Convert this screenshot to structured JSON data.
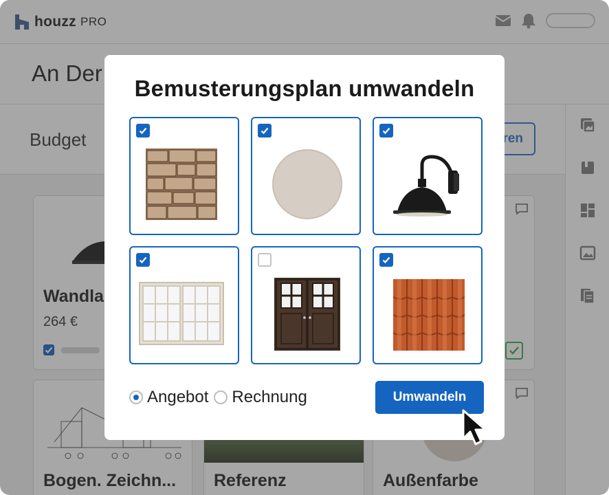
{
  "app": {
    "logo_text": "houzz",
    "logo_suffix": "PRO",
    "page_title": "An Der",
    "tab_budget": "Budget",
    "outline_button_label": "ren"
  },
  "cards": [
    {
      "title": "Wandla",
      "price": "264 €"
    },
    {
      "title": "Bogen. Zeichn..."
    },
    {
      "title": "Referenz"
    },
    {
      "title": "Außenfarbe"
    }
  ],
  "modal": {
    "title": "Bemusterungsplan umwandeln",
    "items": [
      {
        "name": "stone-wall",
        "checked": true
      },
      {
        "name": "paint-color",
        "checked": true
      },
      {
        "name": "barn-lamp",
        "checked": true
      },
      {
        "name": "sliding-window",
        "checked": true
      },
      {
        "name": "double-door",
        "checked": false
      },
      {
        "name": "roof-tiles",
        "checked": true
      }
    ],
    "radio_options": [
      {
        "label": "Angebot",
        "selected": true
      },
      {
        "label": "Rechnung",
        "selected": false
      }
    ],
    "convert_button": "Umwandeln"
  },
  "colors": {
    "accent": "#1565c0",
    "dim_overlay": "rgba(60,60,60,0.45)"
  }
}
